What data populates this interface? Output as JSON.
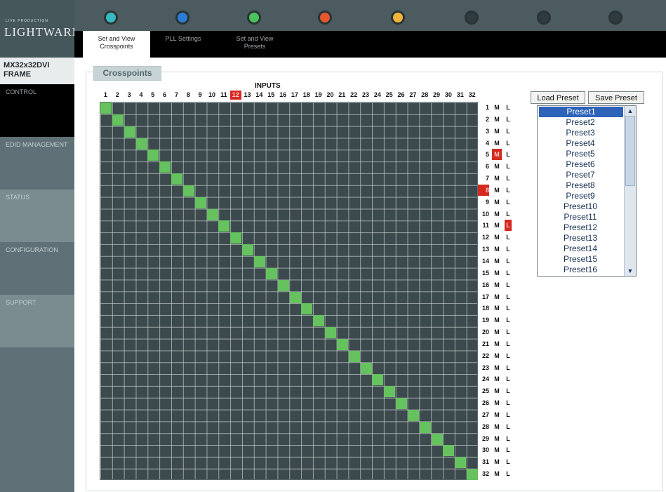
{
  "logo": {
    "small_text": "LIVE PRODUCTION",
    "main_text": "LIGHTWARE"
  },
  "leds": [
    {
      "color": "#35b9c5"
    },
    {
      "color": "#2c7dd6"
    },
    {
      "color": "#49c45c"
    },
    {
      "color": "#e4572e"
    },
    {
      "color": "#f0b43a"
    },
    {
      "color": "#2f3b3e"
    },
    {
      "color": "#2f3b3e"
    },
    {
      "color": "#2f3b3e"
    }
  ],
  "tabs": [
    {
      "label": "Set and View Crosspoints"
    },
    {
      "label": "PLL Settings"
    },
    {
      "label": "Set and View Presets"
    }
  ],
  "device": {
    "name": "MX32x32DVI FRAME"
  },
  "menu": [
    {
      "label": "CONTROL"
    },
    {
      "label": "EDID MANAGEMENT"
    },
    {
      "label": "STATUS"
    },
    {
      "label": "CONFIGURATION"
    },
    {
      "label": "SUPPORT"
    }
  ],
  "panel": {
    "title": "Crosspoints",
    "inputs_label": "INPUTS"
  },
  "inputs": [
    "1",
    "2",
    "3",
    "4",
    "5",
    "6",
    "7",
    "8",
    "9",
    "10",
    "11",
    "12",
    "13",
    "14",
    "15",
    "16",
    "17",
    "18",
    "19",
    "20",
    "21",
    "22",
    "23",
    "24",
    "25",
    "26",
    "27",
    "28",
    "29",
    "30",
    "31",
    "32"
  ],
  "highlighted_input": "12",
  "outputs": [
    "1",
    "2",
    "3",
    "4",
    "5",
    "6",
    "7",
    "8",
    "9",
    "10",
    "11",
    "12",
    "13",
    "14",
    "15",
    "16",
    "17",
    "18",
    "19",
    "20",
    "21",
    "22",
    "23",
    "24",
    "25",
    "26",
    "27",
    "28",
    "29",
    "30",
    "31",
    "32"
  ],
  "output_flags": {
    "m": "M",
    "l": "L",
    "highlighted_output": "8",
    "highlighted_m_row": "5",
    "highlighted_l_row": "11"
  },
  "crosspoints": [
    [
      1,
      1
    ],
    [
      2,
      2
    ],
    [
      3,
      3
    ],
    [
      4,
      4
    ],
    [
      5,
      5
    ],
    [
      6,
      6
    ],
    [
      7,
      7
    ],
    [
      8,
      8
    ],
    [
      9,
      9
    ],
    [
      10,
      10
    ],
    [
      11,
      11
    ],
    [
      12,
      12
    ],
    [
      13,
      13
    ],
    [
      14,
      14
    ],
    [
      15,
      15
    ],
    [
      16,
      16
    ],
    [
      17,
      17
    ],
    [
      18,
      18
    ],
    [
      19,
      19
    ],
    [
      20,
      20
    ],
    [
      21,
      21
    ],
    [
      22,
      22
    ],
    [
      23,
      23
    ],
    [
      24,
      24
    ],
    [
      25,
      25
    ],
    [
      26,
      26
    ],
    [
      27,
      27
    ],
    [
      28,
      28
    ],
    [
      29,
      29
    ],
    [
      30,
      30
    ],
    [
      31,
      31
    ],
    [
      32,
      32
    ]
  ],
  "buttons": {
    "load": "Load Preset",
    "save": "Save Preset"
  },
  "presets": [
    "Preset1",
    "Preset2",
    "Preset3",
    "Preset4",
    "Preset5",
    "Preset6",
    "Preset7",
    "Preset8",
    "Preset9",
    "Preset10",
    "Preset11",
    "Preset12",
    "Preset13",
    "Preset14",
    "Preset15",
    "Preset16"
  ],
  "selected_preset": "Preset1",
  "scroll_icons": {
    "up": "▲",
    "down": "▼"
  }
}
